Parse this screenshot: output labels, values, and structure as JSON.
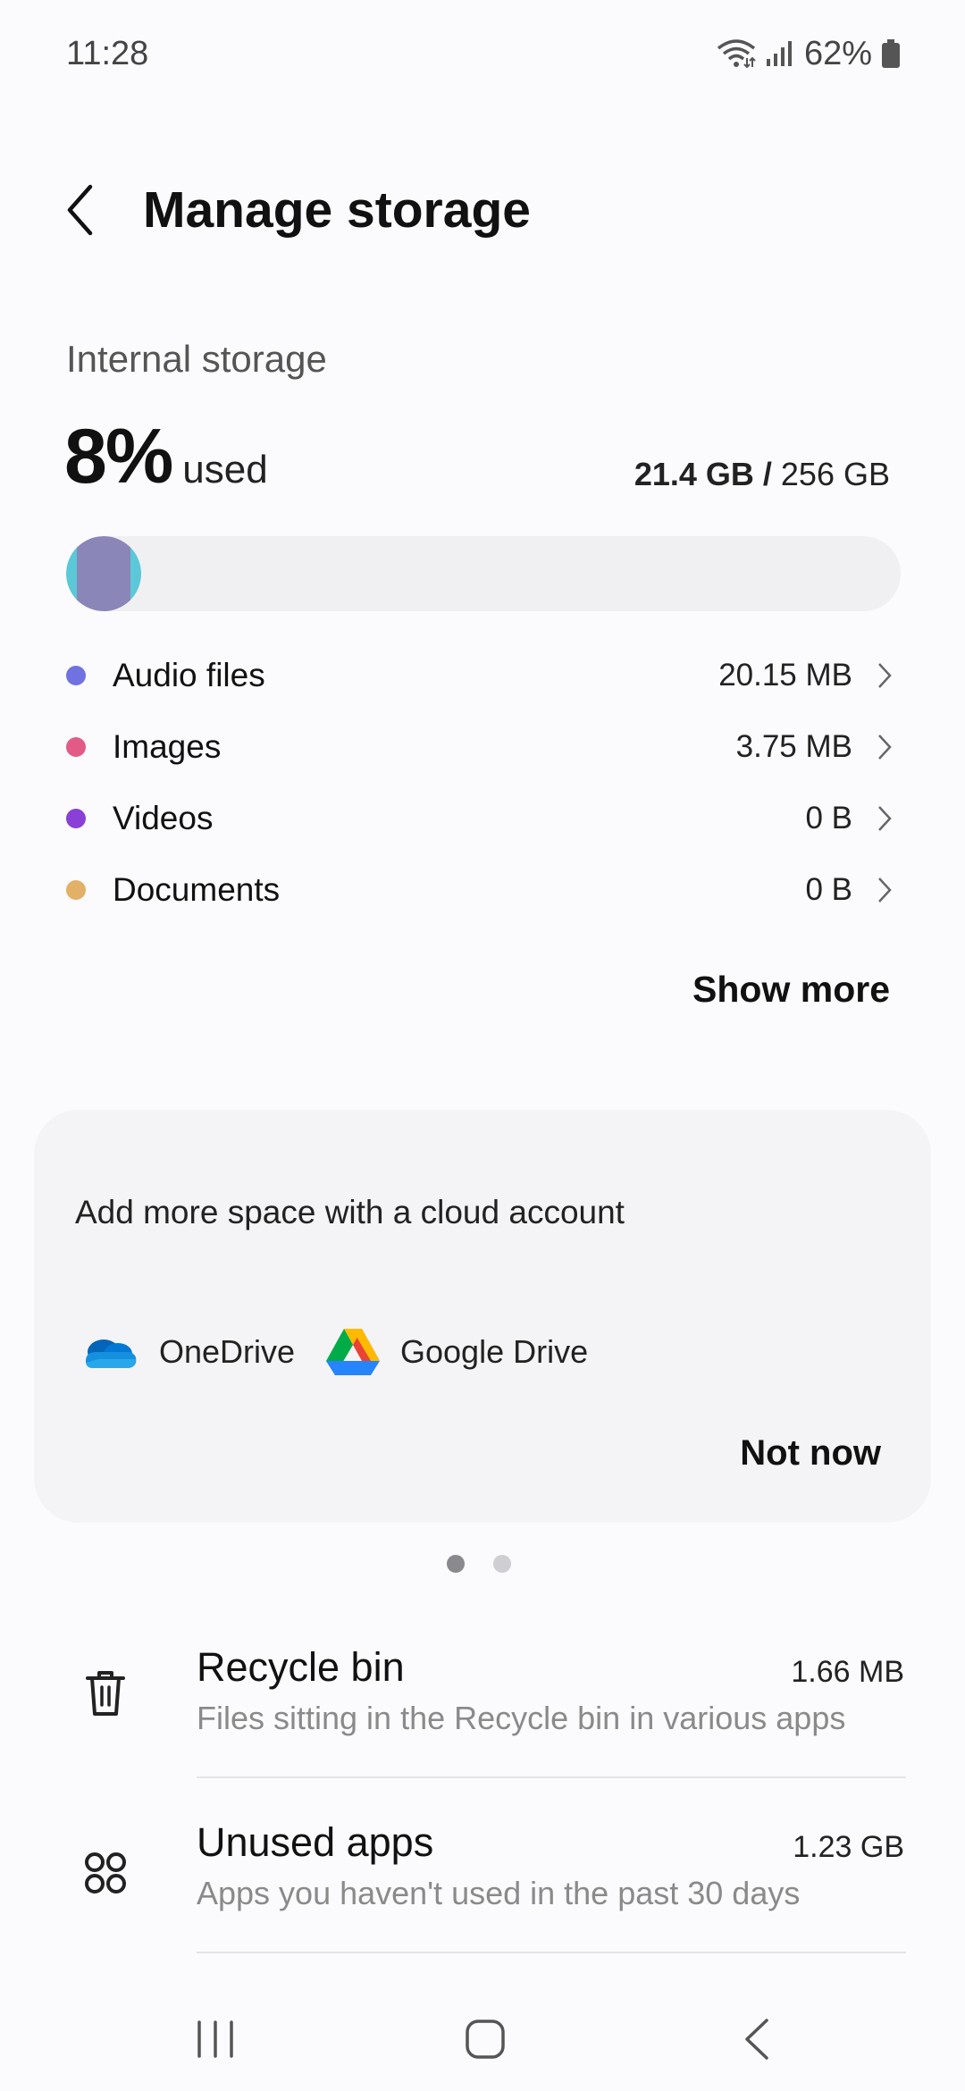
{
  "status_bar": {
    "time": "11:28",
    "battery": "62%"
  },
  "app_bar": {
    "title": "Manage storage"
  },
  "storage": {
    "label": "Internal storage",
    "percent": "8%",
    "percent_suffix": "used",
    "used": "21.4 GB",
    "separator": " / ",
    "total": "256 GB",
    "bar_fill_fraction": 0.08,
    "categories": [
      {
        "name": "Audio files",
        "size": "20.15 MB",
        "color": "#6f72e0"
      },
      {
        "name": "Images",
        "size": "3.75 MB",
        "color": "#e25b86"
      },
      {
        "name": "Videos",
        "size": "0 B",
        "color": "#8a3fd6"
      },
      {
        "name": "Documents",
        "size": "0 B",
        "color": "#e2b066"
      }
    ],
    "show_more": "Show more"
  },
  "cloud_card": {
    "title": "Add more space with a cloud account",
    "options": [
      {
        "label": "OneDrive",
        "icon": "onedrive-icon"
      },
      {
        "label": "Google Drive",
        "icon": "google-drive-icon"
      }
    ],
    "dismiss": "Not now",
    "page_indicator": {
      "count": 2,
      "active": 0
    }
  },
  "items": [
    {
      "title": "Recycle bin",
      "subtitle": "Files sitting in the Recycle bin in various apps",
      "size": "1.66 MB",
      "icon": "trash-icon"
    },
    {
      "title": "Unused apps",
      "subtitle": "Apps you haven't used in the past 30 days",
      "size": "1.23 GB",
      "icon": "apps-icon"
    }
  ],
  "nav": {
    "recents": "recents-icon",
    "home": "home-icon",
    "back": "back-icon"
  },
  "colors": {
    "bar_cyan": "#5bc8d8",
    "bar_purple": "#8a86b8",
    "background": "#fbfbfe"
  }
}
